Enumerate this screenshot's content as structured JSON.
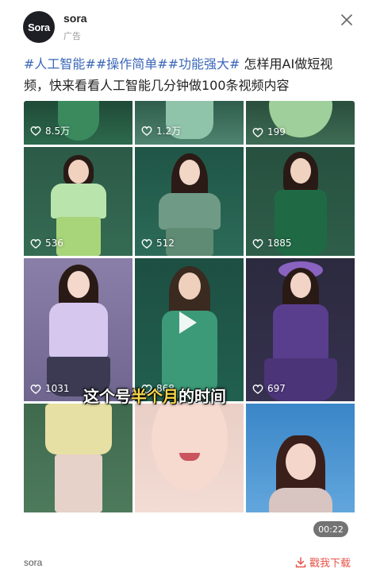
{
  "sponsor": {
    "avatar_text": "Sora",
    "name": "sora",
    "ad_label": "广告"
  },
  "caption": {
    "tags": "#人工智能##操作简单##功能强大#",
    "text": " 怎样用AI做短视频，快来看看人工智能几分钟做100条视频内容"
  },
  "media": {
    "likes": [
      "8.5万",
      "1.2万",
      "199",
      "536",
      "512",
      "1885",
      "1031",
      "868",
      "697"
    ],
    "subtitle_before": "这个号",
    "subtitle_highlight": "半个月",
    "subtitle_after": "的时间",
    "duration": "00:22"
  },
  "footer": {
    "name": "sora",
    "download_label": "戳我下载"
  },
  "colors": {
    "tag_blue": "#3b67b8",
    "download_red": "#e8534a",
    "subtitle_yellow": "#f7d64a"
  }
}
